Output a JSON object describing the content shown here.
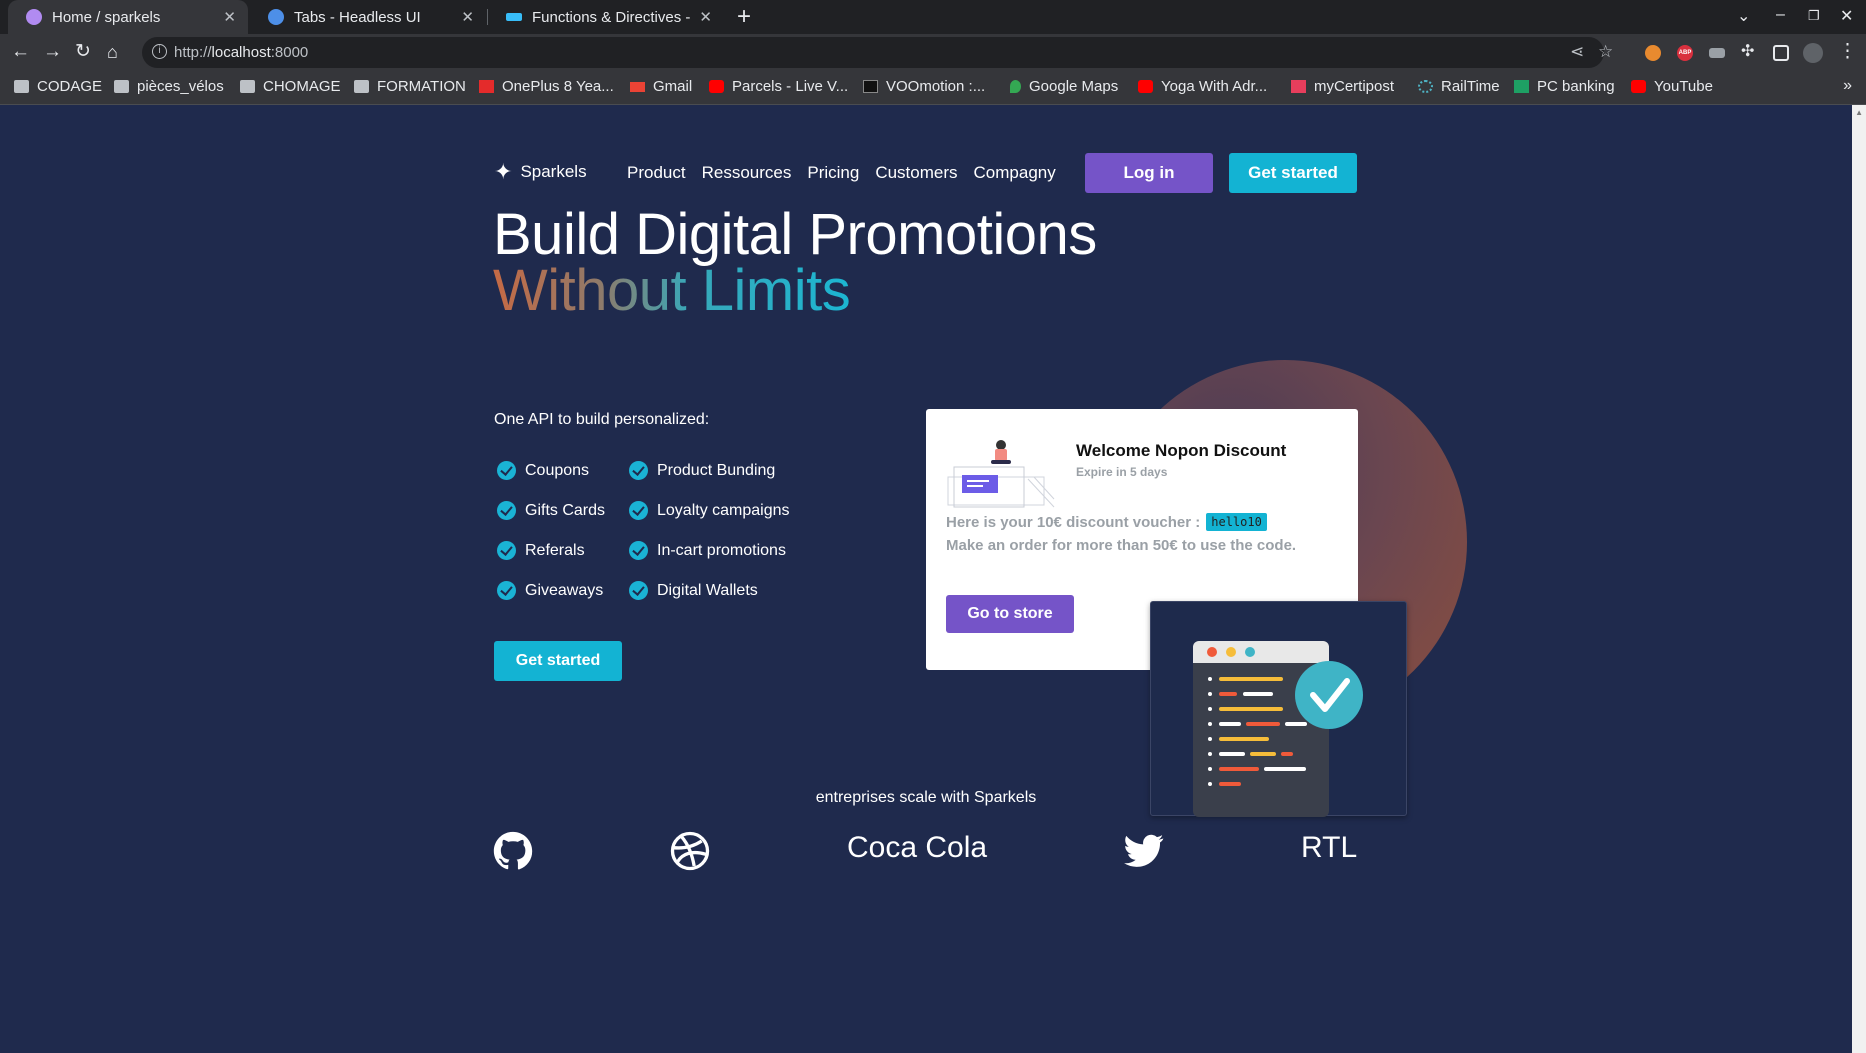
{
  "browser": {
    "tabs": [
      {
        "title": "Home / sparkels",
        "active": true
      },
      {
        "title": "Tabs - Headless UI",
        "active": false
      },
      {
        "title": "Functions & Directives - T",
        "active": false
      }
    ],
    "url": {
      "prefix": "http://",
      "host": "localhost",
      "port": ":8000"
    },
    "bookmarks": [
      "CODAGE",
      "pièces_vélos",
      "CHOMAGE",
      "FORMATION",
      "OnePlus 8 Yea...",
      "Gmail",
      "Parcels - Live V...",
      "VOOmotion :...",
      "Google Maps",
      "Yoga With Adr...",
      "myCertipost",
      "RailTime",
      "PC banking",
      "YouTube"
    ],
    "bookmarks_more": "»",
    "ext_abp_label": "ABP"
  },
  "site": {
    "brand": "Sparkels",
    "nav": [
      "Product",
      "Ressources",
      "Pricing",
      "Customers",
      "Compagny"
    ],
    "login_label": "Log in",
    "get_started_label": "Get started"
  },
  "hero": {
    "line1": "Build Digital Promotions",
    "line2": "Without Limits",
    "intro": "One API to build personalized:",
    "features_left": [
      "Coupons",
      "Gifts Cards",
      "Referals",
      "Giveaways"
    ],
    "features_right": [
      "Product Bunding",
      "Loyalty campaigns",
      "In-cart promotions",
      "Digital Wallets"
    ],
    "cta_label": "Get started"
  },
  "voucher_card": {
    "title": "Welcome Nopon Discount",
    "subtitle": "Expire in 5 days",
    "text1": "Here is your 10€ discount voucher :",
    "code": "hello10",
    "text2": "Make an order for more than 50€ to use the code.",
    "button_label": "Go to store"
  },
  "trust": {
    "tagline": "entreprises scale with Sparkels",
    "logos": [
      "github",
      "dribbble",
      "Coca Cola",
      "twitter",
      "RTL"
    ]
  },
  "colors": {
    "page_bg": "#1f2a4d",
    "purple": "#7554c8",
    "cyan": "#13b3d3"
  }
}
